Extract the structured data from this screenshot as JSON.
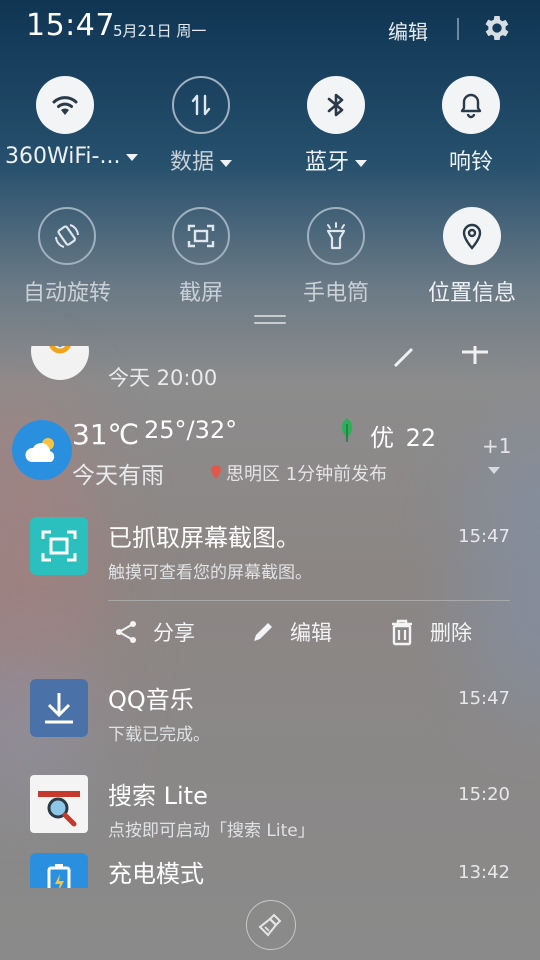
{
  "status_bar": {
    "time": "15:47",
    "date": "5月21日 周一",
    "edit": "编辑",
    "settings_icon": "gear-icon"
  },
  "quick_settings": {
    "row1": [
      {
        "label": "360WiFi-...",
        "icon": "wifi-icon",
        "active": true,
        "has_dropdown": true
      },
      {
        "label": "数据",
        "icon": "mobile-data-icon",
        "active": false,
        "has_dropdown": true
      },
      {
        "label": "蓝牙",
        "icon": "bluetooth-icon",
        "active": true,
        "has_dropdown": true
      },
      {
        "label": "响铃",
        "icon": "bell-icon",
        "active": true,
        "has_dropdown": false
      }
    ],
    "row2": [
      {
        "label": "自动旋转",
        "icon": "auto-rotate-icon",
        "active": false
      },
      {
        "label": "截屏",
        "icon": "screenshot-icon",
        "active": false
      },
      {
        "label": "手电筒",
        "icon": "flashlight-icon",
        "active": false
      },
      {
        "label": "位置信息",
        "icon": "location-icon",
        "active": true
      }
    ]
  },
  "notifications": {
    "partial": {
      "subtitle": "今天 20:00"
    },
    "weather": {
      "temp": "31℃",
      "range": "25°/32°",
      "aqi_label": "优",
      "aqi_value": "22",
      "desc": "今天有雨",
      "location_meta": "思明区 1分钟前发布",
      "extra_count": "+1"
    },
    "screenshot": {
      "title": "已抓取屏幕截图。",
      "subtitle": "触摸可查看您的屏幕截图。",
      "time": "15:47",
      "actions": {
        "share": "分享",
        "edit": "编辑",
        "delete": "删除"
      }
    },
    "qqmusic": {
      "title": "QQ音乐",
      "subtitle": "下载已完成。",
      "time": "15:47"
    },
    "search": {
      "title": "搜索 Lite",
      "subtitle": "点按即可启动「搜索 Lite」",
      "time": "15:20"
    },
    "charge": {
      "title": "充电模式",
      "time": "13:42"
    }
  },
  "colors": {
    "screenshot_icon_bg": "#2bbfbd",
    "qqmusic_icon_bg": "#4a72a8",
    "weather_icon_bg": "#2b8fe0",
    "aqi_leaf": "#2eae5a",
    "location_pin": "#e0584a"
  }
}
